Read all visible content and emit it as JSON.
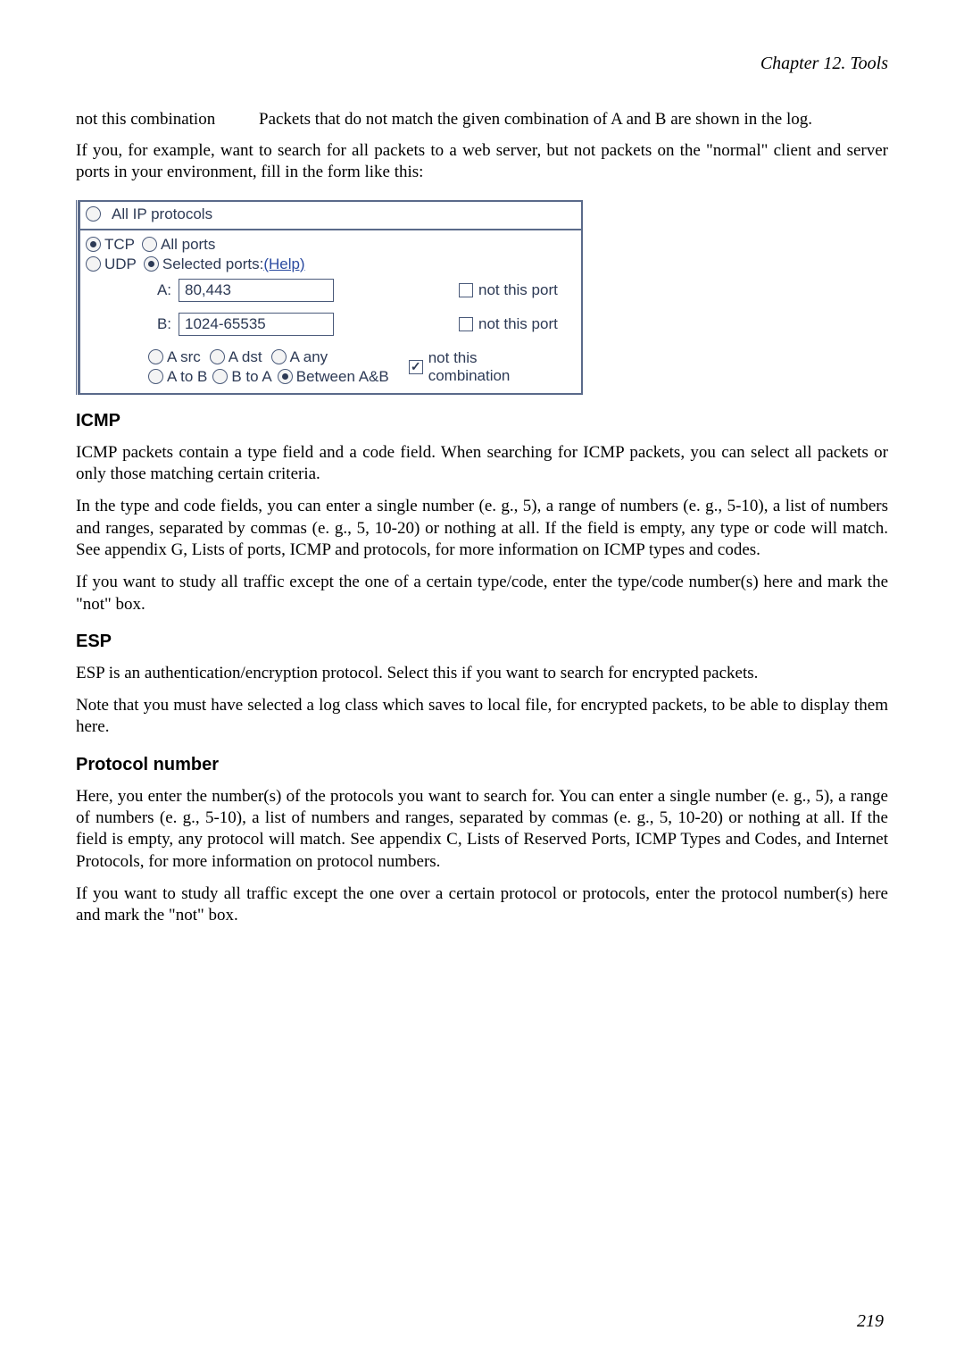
{
  "chapter": "Chapter 12. Tools",
  "def": {
    "term": "not this combination",
    "desc": "Packets that do not match the given combination of A and B are shown in the log."
  },
  "para_intro": "If you, for example, want to search for all packets to a web server, but not packets on the \"normal\" client and server ports in your environment, fill in the form like this:",
  "figure": {
    "all_ip": "All IP protocols",
    "tcp": "TCP",
    "udp": "UDP",
    "all_ports": "All ports",
    "selected_ports": "Selected ports:",
    "help": "(Help)",
    "a_label": "A:",
    "a_value": "80,443",
    "b_label": "B:",
    "b_value": "1024-65535",
    "not_this_port": "not this port",
    "a_src": "A src",
    "a_dst": "A dst",
    "a_any": "A any",
    "a_to_b": "A to B",
    "b_to_a": "B to A",
    "between_ab": "Between A&B",
    "not_this": "not this",
    "combination": "combination"
  },
  "icmp": {
    "heading": "ICMP",
    "p1": "ICMP packets contain a type field and a code field. When searching for ICMP packets, you can select all packets or only those matching certain criteria.",
    "p2": "In the type and code fields, you can enter a single number (e. g., 5), a range of numbers (e. g., 5-10), a list of numbers and ranges, separated by commas (e. g., 5, 10-20) or nothing at all. If the field is empty, any type or code will match. See appendix G, Lists of ports, ICMP and protocols, for more information on ICMP types and codes.",
    "p3": "If you want to study all traffic except the one of a certain type/code, enter the type/code number(s) here and mark the \"not\" box."
  },
  "esp": {
    "heading": "ESP",
    "p1": "ESP is an authentication/encryption protocol. Select this if you want to search for encrypted packets.",
    "p2": "Note that you must have selected a log class which saves to local file, for encrypted packets, to be able to display them here."
  },
  "protonum": {
    "heading": "Protocol number",
    "p1": "Here, you enter the number(s) of the protocols you want to search for. You can enter a single number (e. g., 5), a range of numbers (e. g., 5-10), a list of numbers and ranges, separated by commas (e. g., 5, 10-20) or nothing at all. If the field is empty, any protocol will match. See appendix C, Lists of Reserved Ports, ICMP Types and Codes, and Internet Protocols, for more information on protocol numbers.",
    "p2": "If you want to study all traffic except the one over a certain protocol or protocols, enter the protocol number(s) here and mark the \"not\" box."
  },
  "page_number": "219"
}
